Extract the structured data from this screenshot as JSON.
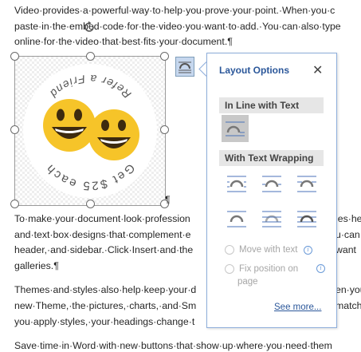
{
  "document": {
    "lines": [
      "Video·provides·a·powerful·way·to·help·you·prove·your·point.·When·you·c",
      "paste·in·the·embed·code·for·the·video·you·want·to·add.·You·can·also·type",
      "online·for·the·video·that·best·fits·your·document.¶",
      "To·make·your·document·look·profession",
      "and·text·box·designs·that·complement·e",
      "header,·and·sidebar.·Click·Insert·and·the",
      "galleries.¶",
      "Themes·and·styles·also·help·keep·your·d",
      "new·Theme,·the·pictures,·charts,·and·Sm",
      "you·apply·styles,·your·headings·change·t",
      "Save·time·in·Word·with·new·buttons·that·show·up·where·you·need·them"
    ],
    "lines_right": [
      "les·he",
      "u·can·",
      "want",
      "en·you",
      "match",
      ""
    ],
    "pilcrow": "¶",
    "image_top_text": "Get $25 each",
    "image_bottom_text": "Refer a Friend"
  },
  "panel": {
    "title": "Layout Options",
    "close_label": "✕",
    "section_inline": "In Line with Text",
    "section_wrapping": "With Text Wrapping",
    "move_with_text": "Move with text",
    "fix_position_line1": "Fix position on",
    "fix_position_line2": "page",
    "see_more": "See more...",
    "info_glyph": "i"
  },
  "colors": {
    "accent": "#2b579a",
    "panel_border": "#8eaedb",
    "emoji_yellow": "#f6c429"
  }
}
